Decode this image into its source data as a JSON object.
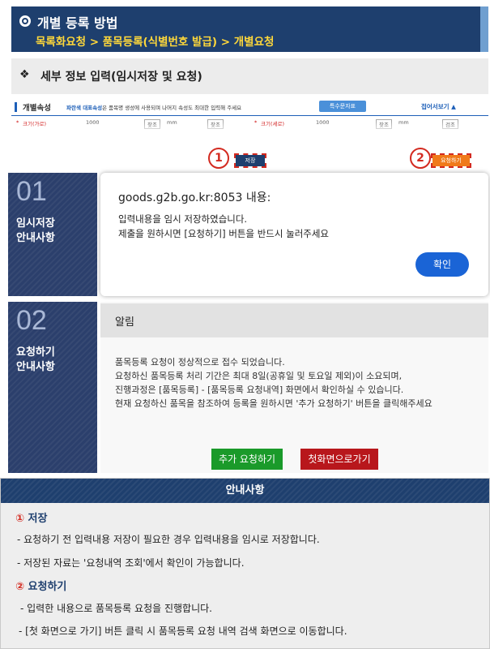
{
  "header": {
    "title": "개별 등록 방법",
    "subtitle": "목록화요청 > 품목등록(식별번호 발급) > 개별요청"
  },
  "section": {
    "title": "세부 정보 입력(임시저장 및 요청)"
  },
  "mini_form": {
    "title": "개별속성",
    "note_bold": "파란색 대표속성",
    "note_rest": "은 품목명 생성에 사용되며 나머지 속성도 최대한 입력해 주세요",
    "special_button": "특수문자표",
    "collapse_link": "접어서보기 ▲",
    "field1_label": "크기(가로)",
    "field1_value": "1000",
    "field1_unit": "mm",
    "field2_label": "크기(세로)",
    "field2_value": "1000",
    "field2_unit": "mm",
    "search_label": "찾조",
    "search_label2": "찾조",
    "search_label3": "검조"
  },
  "markers": {
    "m1": "1",
    "m2": "2",
    "save_tag": "저장",
    "request_tag": "요청하기"
  },
  "step1": {
    "num": "01",
    "name_line1": "임시저장",
    "name_line2": "안내사항"
  },
  "dialog1": {
    "host": "goods.g2b.go.kr:8053 내용:",
    "line1": "입력내용을 임시 저장하였습니다.",
    "line2": "제출을 원하시면 [요청하기] 버튼을 반드시 눌러주세요",
    "ok_button": "확인"
  },
  "step2": {
    "num": "02",
    "name_line1": "요청하기",
    "name_line2": "안내사항"
  },
  "dialog2": {
    "title": "알림",
    "line1": "품목등록 요청이 정상적으로 접수 되었습니다.",
    "line2": "요청하신 품목등록 처리 기간은 최대 8일(공휴일 및 토요일 제외)이 소요되며,",
    "line3": "진행과정은 [품목등록] - [품목등록 요청내역] 화면에서 확인하실 수 있습니다.",
    "line4": "현재 요청하신 품목을 참조하여 등록을 원하시면 '추가 요청하기' 버튼을 클릭해주세요",
    "add_button": "추가 요청하기",
    "home_button": "첫화면으로가기"
  },
  "guide": {
    "title": "안내사항",
    "item1_circle": "①",
    "item1_title": "저장",
    "item1_line1": "- 요청하기 전 입력내용 저장이 필요한 경우 입력내용을 임시로 저장합니다.",
    "item1_line2": "- 저장된 자료는 '요청내역 조회'에서 확인이 가능합니다.",
    "item2_circle": "②",
    "item2_title": "요청하기",
    "item2_line1": "- 입력한 내용으로 품목등록 요청을 진행합니다.",
    "item2_line2": "- [첫 화면으로 가기] 버튼 클릭 시  품목등록 요청 내역 검색 화면으로 이동합니다."
  }
}
